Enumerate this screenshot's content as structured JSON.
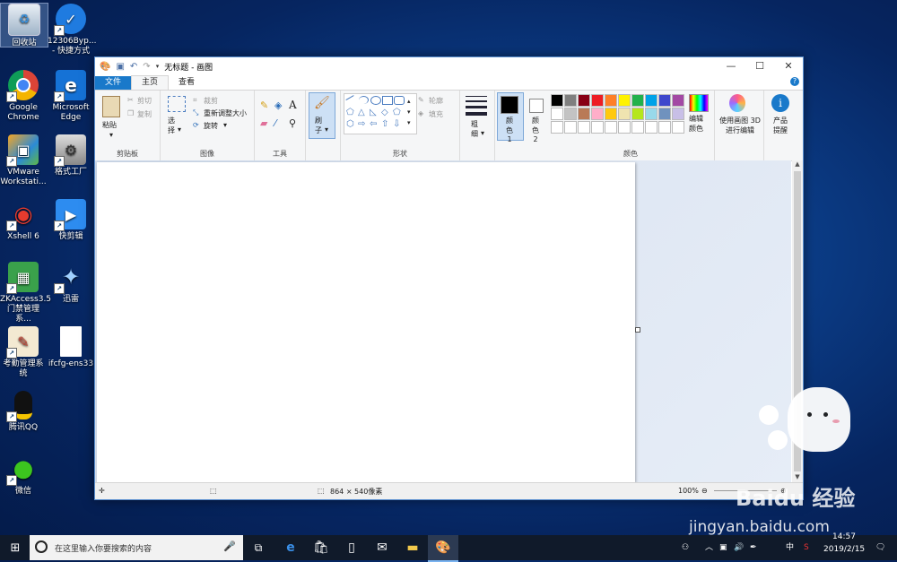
{
  "desktop": {
    "icons": [
      {
        "label": "回收站"
      },
      {
        "label": "12306Byp... - 快捷方式"
      },
      {
        "label": "Google Chrome"
      },
      {
        "label": "Microsoft Edge"
      },
      {
        "label": "VMware Workstati..."
      },
      {
        "label": "格式工厂"
      },
      {
        "label": "Xshell 6"
      },
      {
        "label": "快剪辑"
      },
      {
        "label": "ZKAccess3.5 门禁管理系..."
      },
      {
        "label": "迅雷"
      },
      {
        "label": "考勤管理系统"
      },
      {
        "label": "ifcfg-ens33"
      },
      {
        "label": "腾讯QQ"
      },
      {
        "label": "微信"
      }
    ]
  },
  "window": {
    "title": "无标题 - 画图",
    "controls": {
      "minimize": "—",
      "maximize": "☐",
      "close": "✕"
    },
    "tabs": {
      "file": "文件",
      "home": "主页",
      "view": "查看"
    },
    "help": "?"
  },
  "ribbon": {
    "clipboard": {
      "paste": "粘贴",
      "cut": "剪切",
      "copy": "复制",
      "label": "剪贴板"
    },
    "image": {
      "select": "选择",
      "crop": "裁剪",
      "resize": "重新调整大小",
      "rotate": "旋转",
      "label": "图像"
    },
    "tools": {
      "label": "工具",
      "text": "A"
    },
    "brushes": {
      "label": "刷子"
    },
    "shapes": {
      "outline": "轮廓",
      "fill": "填充",
      "label": "形状"
    },
    "size": {
      "label": "粗细"
    },
    "color1": {
      "label": "颜色 1"
    },
    "color2": {
      "label": "颜色 2"
    },
    "colors": {
      "label": "颜色",
      "edit": "编辑颜色",
      "row1": [
        "#000000",
        "#7f7f7f",
        "#880015",
        "#ed1c24",
        "#ff7f27",
        "#fff200",
        "#22b14c",
        "#00a2e8",
        "#3f48cc",
        "#a349a4"
      ],
      "row2": [
        "#ffffff",
        "#c3c3c3",
        "#b97a57",
        "#ffaec9",
        "#ffc90e",
        "#efe4b0",
        "#b5e61d",
        "#99d9ea",
        "#7092be",
        "#c8bfe7"
      ]
    },
    "paint3d": {
      "label": "使用画图 3D 进行编辑"
    },
    "tips": {
      "label": "产品提醒"
    }
  },
  "statusbar": {
    "size": "864 × 540像素",
    "zoom": "100%"
  },
  "taskbar": {
    "search_placeholder": "在这里输入你要搜索的内容",
    "ime": "中",
    "time": "14:57",
    "date": "2019/2/15"
  },
  "watermark": {
    "brand": "Baidu 经验",
    "url": "jingyan.baidu.com"
  }
}
